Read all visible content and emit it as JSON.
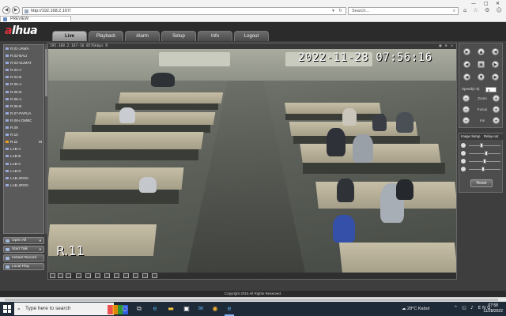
{
  "browser": {
    "url": "http://192.168.2.167/",
    "search_placeholder": "Search...",
    "tab_title": "PREVIEW",
    "back": "◀",
    "forward": "▶",
    "minimize": "—",
    "maximize": "□",
    "close": "✕",
    "toolbar_icons": "⌂ ☆ ⚙ ☺",
    "addr_tools": "▾ ↻",
    "search_icon": "⌕"
  },
  "app": {
    "logo_pre": "al",
    "logo_a": "",
    "logo_text": "alhua",
    "menu": [
      "Live",
      "Playback",
      "Alarm",
      "Setup",
      "Info",
      "Logout"
    ],
    "active_menu": "Live",
    "footer": "Copyright 2015 All Rights Reserved."
  },
  "channels": [
    {
      "label": "R.01-JAWA",
      "flag": ""
    },
    {
      "label": "R.02-BALI",
      "flag": ""
    },
    {
      "label": "R.03-SUMAT",
      "flag": ""
    },
    {
      "label": "R.04-A",
      "flag": ""
    },
    {
      "label": "R.04-B",
      "flag": ""
    },
    {
      "label": "R.05-A",
      "flag": ""
    },
    {
      "label": "R.05-B",
      "flag": ""
    },
    {
      "label": "R.06-A",
      "flag": ""
    },
    {
      "label": "R.06-B",
      "flag": ""
    },
    {
      "label": "R.07-PAPUA",
      "flag": ""
    },
    {
      "label": "R.08-LOMBC",
      "flag": ""
    },
    {
      "label": "R.09",
      "flag": ""
    },
    {
      "label": "R.10",
      "flag": ""
    },
    {
      "label": "R.11",
      "flag": "M"
    },
    {
      "label": "LAB-A",
      "flag": ""
    },
    {
      "label": "LAB-B",
      "flag": ""
    },
    {
      "label": "LAB-C",
      "flag": ""
    },
    {
      "label": "LAB-D",
      "flag": ""
    },
    {
      "label": "LAB-JRGN",
      "flag": ""
    },
    {
      "label": "LAB-JRGN",
      "flag": ""
    }
  ],
  "selected_channel": "R.11",
  "left_buttons": [
    "Open All",
    "Start Talk",
    "Instant Record",
    "Local Play"
  ],
  "video": {
    "title": "192.168.2.167-16 8576kbps R",
    "timestamp": "2022-11-28  07:56:16",
    "camera_label": "R.11",
    "title_icons": "▣ ⚙ ✕"
  },
  "ptz": {
    "speed_label": "Speed(1-8)",
    "speed_value": "5",
    "zoom": "Zoom",
    "focus": "Focus",
    "iris": "Iris",
    "minus": "−",
    "plus": "+",
    "arrows": [
      "▶",
      "▲",
      "◀",
      "◀",
      "▣",
      "▶",
      "◀",
      "▼",
      "▶"
    ]
  },
  "image_setup": {
    "title": "Image Setup",
    "relay": "Relay-out",
    "reset": "Reset",
    "levels": [
      0.4,
      0.55,
      0.5,
      0.45
    ]
  },
  "taskbar": {
    "search_text": "Type here to search",
    "weather": "28°C  Kabut",
    "time": "07:58",
    "date": "11/28/2022",
    "language": "ENG"
  },
  "colors": {
    "accent_orange": "#f39b1c",
    "logo_red": "#e0313b",
    "bg_dark": "#3e3e3e"
  }
}
